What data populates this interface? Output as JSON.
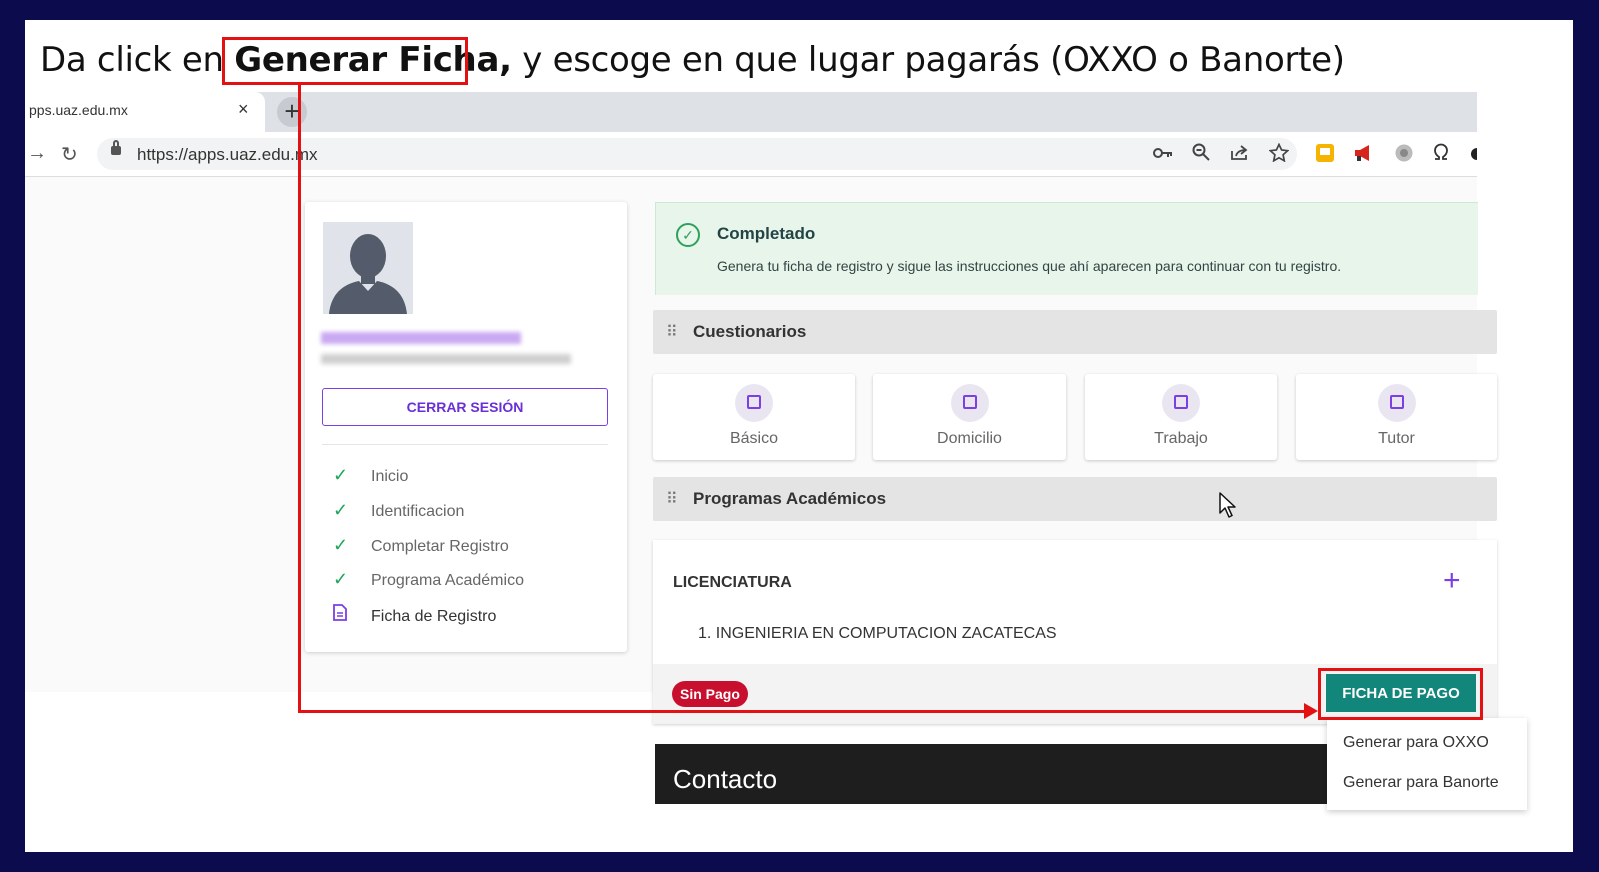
{
  "instruction": {
    "prefix": "Da click en ",
    "highlight": "Generar Ficha,",
    "suffix": " y escoge en que lugar pagarás (OXXO o Banorte)"
  },
  "browser": {
    "tab_title": "pps.uaz.edu.mx",
    "tab_close": "×",
    "new_tab": "+",
    "back": "→",
    "reload": "↻",
    "url": "https://apps.uaz.edu.mx"
  },
  "profile": {
    "logout_label": "CERRAR SESIÓN",
    "steps": [
      {
        "label": "Inicio",
        "done": true
      },
      {
        "label": "Identificacion",
        "done": true
      },
      {
        "label": "Completar Registro",
        "done": true
      },
      {
        "label": "Programa Académico",
        "done": true
      },
      {
        "label": "Ficha de Registro",
        "done": false
      }
    ]
  },
  "alert": {
    "title": "Completado",
    "text": "Genera tu ficha de registro y sigue las instrucciones que ahí aparecen para continuar con tu registro."
  },
  "questionnaires": {
    "title": "Cuestionarios",
    "cards": [
      "Básico",
      "Domicilio",
      "Trabajo",
      "Tutor"
    ]
  },
  "programs": {
    "title": "Programas Académicos",
    "level": "LICENCIATURA",
    "add": "+",
    "item": "1.   INGENIERIA EN COMPUTACION ZACATECAS",
    "status_badge": "Sin Pago",
    "pay_button": "FICHA DE PAGO"
  },
  "pay_menu": {
    "options": [
      "Generar para OXXO",
      "Generar para Banorte"
    ]
  },
  "contact": {
    "title": "Contacto"
  },
  "colors": {
    "slide_border": "#0b0b4e",
    "annotation": "#e31111",
    "primary_purple": "#7b3fe4",
    "pay_teal": "#12867a",
    "badge_red": "#c8102e",
    "success_green": "#2da15a"
  },
  "icons": {
    "toolbar": [
      "key-icon",
      "zoom-icon",
      "share-icon",
      "star-icon",
      "extension-icon",
      "megaphone-icon",
      "settings-icon",
      "omega-icon"
    ]
  }
}
